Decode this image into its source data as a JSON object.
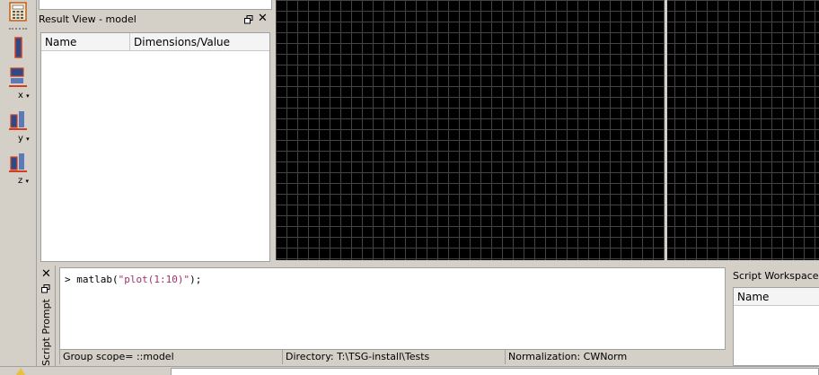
{
  "result_view": {
    "title": "Result View - model",
    "columns": [
      "Name",
      "Dimensions/Value"
    ],
    "float_icon": "float-window-icon",
    "close_icon": "close-icon"
  },
  "toolbar": {
    "axis_labels": [
      "x",
      "y",
      "z"
    ]
  },
  "script_prompt": {
    "panel_title": "Script Prompt",
    "prompt_symbol": ">",
    "command_prefix": "matlab(",
    "command_string": "\"plot(1:10)\"",
    "command_suffix": ");"
  },
  "status_bar": {
    "group_scope": "Group scope= ::model",
    "directory": "Directory: T:\\TSG-install\\Tests",
    "normalization": "Normalization: CWNorm"
  },
  "script_workspace": {
    "title": "Script Workspace",
    "columns": [
      "Name"
    ]
  },
  "colors": {
    "plot_bg": "#000000",
    "grid": "#444444",
    "string_literal": "#a0306a",
    "accent_red": "#d04020",
    "accent_blue": "#2c4a88"
  }
}
